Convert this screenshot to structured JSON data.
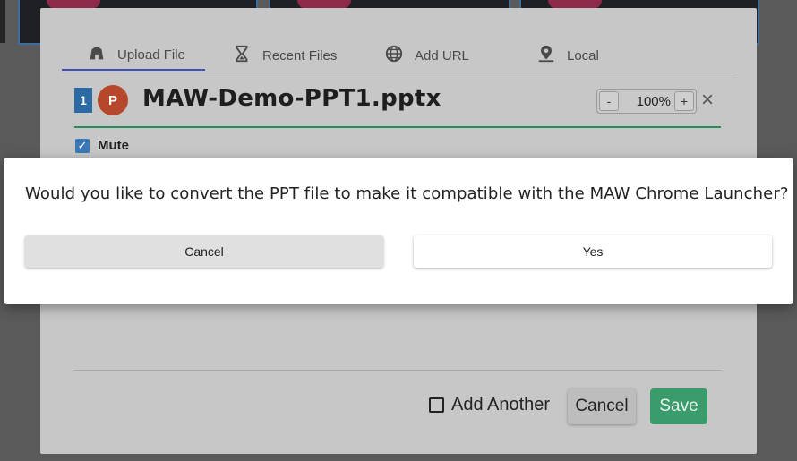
{
  "tabs": [
    {
      "label": "Upload File",
      "icon": "upload-file-icon"
    },
    {
      "label": "Recent Files",
      "icon": "hourglass-icon"
    },
    {
      "label": "Add URL",
      "icon": "globe-icon"
    },
    {
      "label": "Local",
      "icon": "location-pin-icon"
    }
  ],
  "file": {
    "slide_number": "1",
    "app_letter": "P",
    "name": "MAW-Demo-PPT1.pptx",
    "zoom_minus": "-",
    "zoom_value": "100%",
    "zoom_plus": "+",
    "close": "×"
  },
  "mute": {
    "label": "Mute",
    "checked": true
  },
  "footer": {
    "add_another_label": "Add Another",
    "cancel_label": "Cancel",
    "save_label": "Save"
  },
  "confirm": {
    "message": "Would you like to convert the PPT file to make it compatible with the MAW Chrome Launcher?",
    "cancel_label": "Cancel",
    "yes_label": "Yes"
  },
  "colors": {
    "active_tab_underline": "#3f51b5",
    "file_row_underline": "#2a8a5a",
    "save_button": "#3a9b6c",
    "checkbox": "#3a79b8",
    "ppt_icon": "#b7472a"
  }
}
